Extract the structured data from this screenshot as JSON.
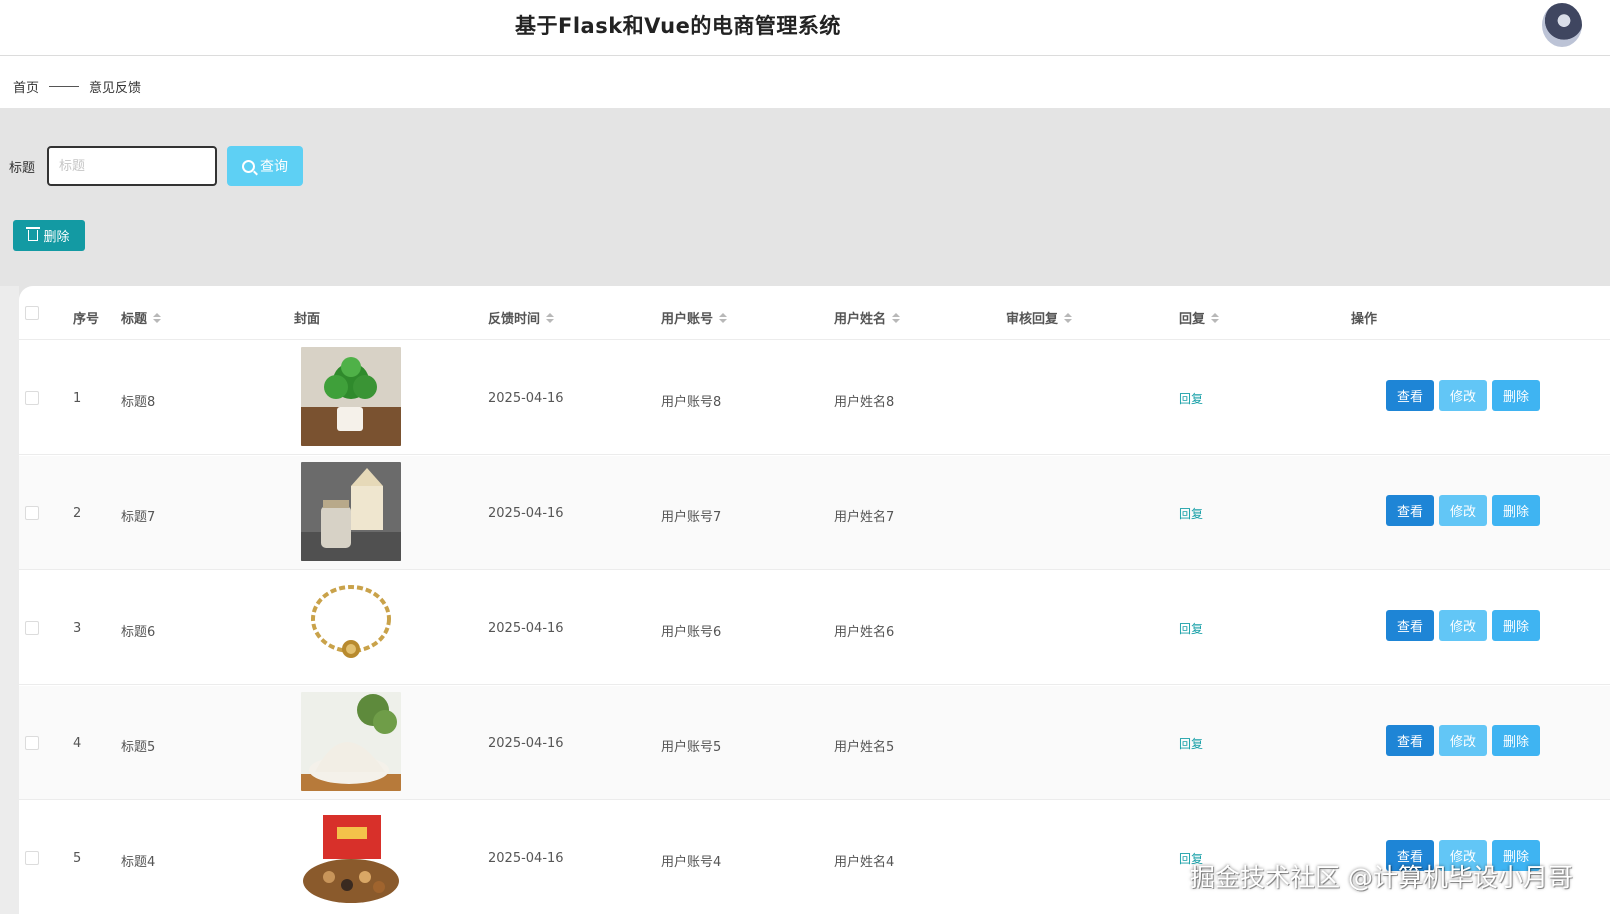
{
  "header": {
    "title": "基于Flask和Vue的电商管理系统"
  },
  "breadcrumb": {
    "home": "首页",
    "current": "意见反馈"
  },
  "search": {
    "label": "标题",
    "placeholder": "标题",
    "button_label": "查询"
  },
  "toolbar": {
    "delete_label": "删除"
  },
  "table": {
    "columns": [
      "序号",
      "标题",
      "封面",
      "反馈时间",
      "用户账号",
      "用户姓名",
      "审核回复",
      "回复",
      "操作"
    ],
    "rows": [
      {
        "index": "1",
        "title": "标题8",
        "cover": "potted-plant",
        "time": "2025-04-16",
        "account": "用户账号8",
        "name": "用户姓名8",
        "review": "",
        "reply": "回复"
      },
      {
        "index": "2",
        "title": "标题7",
        "cover": "jar-and-box",
        "time": "2025-04-16",
        "account": "用户账号7",
        "name": "用户姓名7",
        "review": "",
        "reply": "回复"
      },
      {
        "index": "3",
        "title": "标题6",
        "cover": "gold-bracelet",
        "time": "2025-04-16",
        "account": "用户账号6",
        "name": "用户姓名6",
        "review": "",
        "reply": "回复"
      },
      {
        "index": "4",
        "title": "标题5",
        "cover": "flour-pile",
        "time": "2025-04-16",
        "account": "用户账号5",
        "name": "用户姓名5",
        "review": "",
        "reply": "回复"
      },
      {
        "index": "5",
        "title": "标题4",
        "cover": "nuts-gift-box",
        "time": "2025-04-16",
        "account": "用户账号4",
        "name": "用户姓名4",
        "review": "",
        "reply": "回复"
      }
    ],
    "actions": {
      "view": "查看",
      "edit": "修改",
      "delete": "删除"
    }
  },
  "watermark": "掘金技术社区 @计算机毕设小月哥",
  "colors": {
    "primary_teal": "#139aa3",
    "query_button": "#5ed0f4",
    "view_button": "#1e85d6",
    "edit_button": "#62c6f6",
    "delete_button": "#3fb4f2",
    "reply_link": "#18a0a8"
  }
}
